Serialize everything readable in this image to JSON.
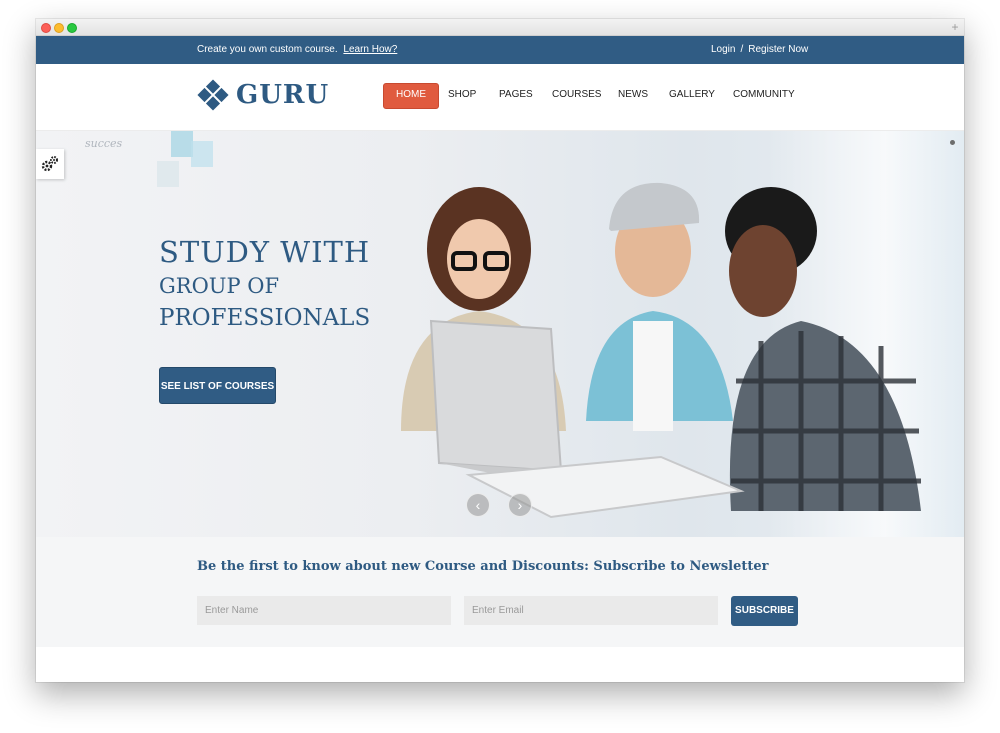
{
  "topbar": {
    "promo_text": "Create you own custom course.",
    "promo_link": "Learn How?",
    "login": "Login",
    "separator": "/",
    "register": "Register Now"
  },
  "header": {
    "logo_text": "GURU",
    "nav": [
      {
        "label": "HOME",
        "active": true
      },
      {
        "label": "SHOP"
      },
      {
        "label": "PAGES"
      },
      {
        "label": "COURSES"
      },
      {
        "label": "NEWS"
      },
      {
        "label": "GALLERY"
      },
      {
        "label": "COMMUNITY"
      }
    ]
  },
  "hero": {
    "title_line1": "STUDY WITH",
    "title_line2": "GROUP OF",
    "title_line3": "PROFESSIONALS",
    "button": "SEE LIST OF COURSES",
    "board_scribble": "succes",
    "prev_arrow": "‹",
    "next_arrow": "›"
  },
  "newsletter": {
    "title": "Be the first to know about new Course and Discounts: Subscribe to Newsletter",
    "name_placeholder": "Enter Name",
    "email_placeholder": "Enter Email",
    "subscribe": "SUBSCRIBE"
  },
  "colors": {
    "brand_blue": "#305c84",
    "accent_orange": "#e05b3f"
  },
  "icons": {
    "settings": "gears-icon",
    "logo": "diamond-logo-icon"
  }
}
